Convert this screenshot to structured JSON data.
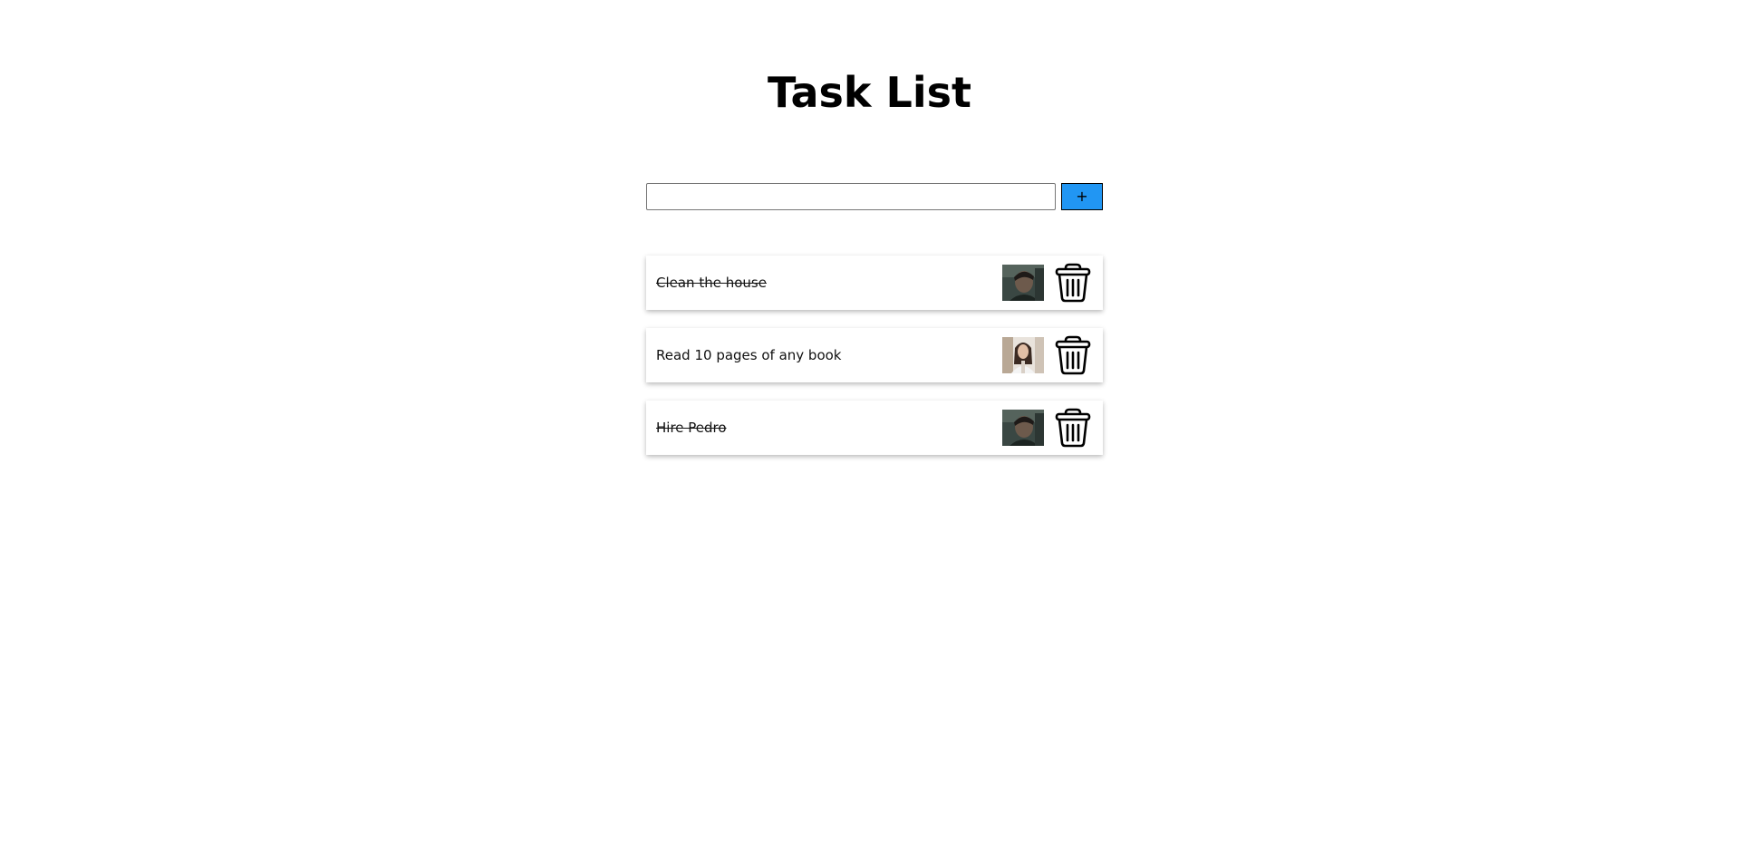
{
  "header": {
    "title": "Task List"
  },
  "form": {
    "input_value": "",
    "input_placeholder": "",
    "add_label": "+"
  },
  "tasks": [
    {
      "text": "Clean the house",
      "done": true,
      "avatar": "man-dark-hair-avatar",
      "delete_icon": "trash-icon"
    },
    {
      "text": "Read 10 pages of any book",
      "done": false,
      "avatar": "woman-avatar",
      "delete_icon": "trash-icon"
    },
    {
      "text": "Hire Pedro",
      "done": true,
      "avatar": "man-dark-hair-avatar",
      "delete_icon": "trash-icon"
    }
  ],
  "colors": {
    "add_button_bg": "#2196f3",
    "text": "#111111"
  }
}
